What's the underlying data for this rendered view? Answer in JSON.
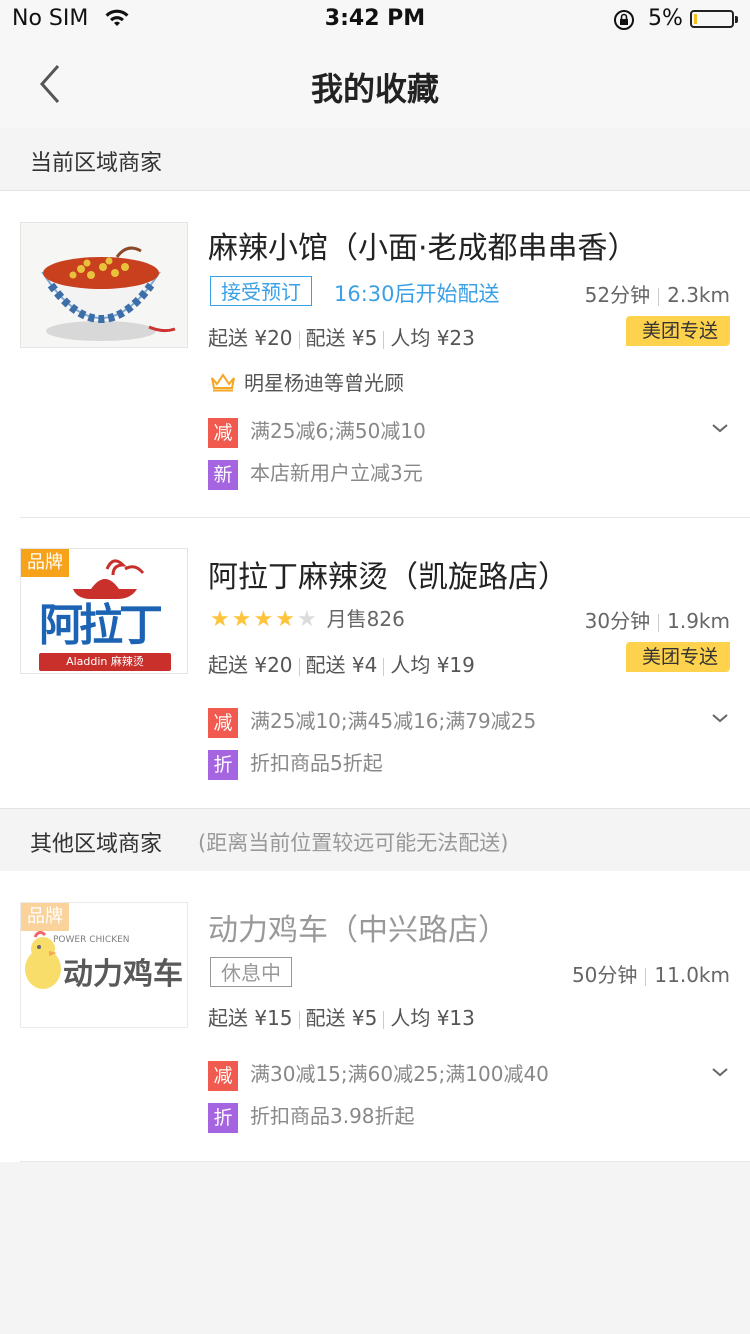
{
  "status": {
    "carrier": "No SIM",
    "time": "3:42 PM",
    "battery": "5%"
  },
  "nav": {
    "title": "我的收藏"
  },
  "sections": {
    "current": {
      "label": "当前区域商家"
    },
    "other": {
      "label": "其他区域商家",
      "note": "(距离当前位置较远可能无法配送)"
    }
  },
  "shops": [
    {
      "name": "麻辣小馆（小面·老成都串串香）",
      "preorder": "接受预订",
      "preorder_time": "16:30后开始配送",
      "time": "52分钟",
      "distance": "2.3km",
      "min_order": "起送 ¥20",
      "delivery_fee": "配送 ¥5",
      "per_capita": "人均 ¥23",
      "delivery_badge": "美团专送",
      "fame": "明星杨迪等曾光顾",
      "promos": [
        {
          "icon": "减",
          "text": "满25减6;满50减10"
        },
        {
          "icon": "新",
          "text": "本店新用户立减3元"
        }
      ]
    },
    {
      "brand": "品牌",
      "name": "阿拉丁麻辣烫（凯旋路店）",
      "rating": 4,
      "monthly_sales": "月售826",
      "time": "30分钟",
      "distance": "1.9km",
      "min_order": "起送 ¥20",
      "delivery_fee": "配送 ¥4",
      "per_capita": "人均 ¥19",
      "delivery_badge": "美团专送",
      "logo_text": "阿拉丁",
      "logo_sub": "Aladdin 麻辣烫",
      "promos": [
        {
          "icon": "减",
          "text": "满25减10;满45减16;满79减25"
        },
        {
          "icon": "折",
          "text": "折扣商品5折起"
        }
      ]
    },
    {
      "brand": "品牌",
      "name": "动力鸡车（中兴路店）",
      "status": "休息中",
      "time": "50分钟",
      "distance": "11.0km",
      "min_order": "起送 ¥15",
      "delivery_fee": "配送 ¥5",
      "per_capita": "人均 ¥13",
      "logo_en": "POWER CHICKEN",
      "logo_cn": "动力鸡车",
      "promos": [
        {
          "icon": "减",
          "text": "满30减15;满60减25;满100减40"
        },
        {
          "icon": "折",
          "text": "折扣商品3.98折起"
        }
      ]
    }
  ]
}
